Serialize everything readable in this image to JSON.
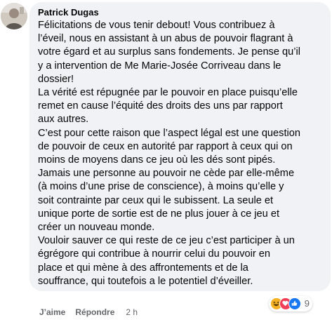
{
  "comment": {
    "author": "Patrick Dugas",
    "paragraphs": [
      "Félicitations de vous tenir debout! Vous contribuez à\nl’éveil, nous en assistant à un abus de pouvoir flagrant à\nvotre égard et au surplus sans fondements. Je pense qu’il\ny a intervention de Me Marie-Josée Corriveau dans le\ndossier!",
      "La vérité est répugnée par le pouvoir en place puisqu’elle\nremet en cause l’équité des droits des uns par rapport\naux autres.",
      "C’est pour cette raison que l’aspect légal est une question\nde pouvoir de ceux en autorité par rapport à ceux qui on\nmoins de moyens dans ce jeu où les dés sont pipés.",
      "Jamais une personne au pouvoir ne cède par elle-même\n(à moins d’une prise de conscience), à moins qu’elle y\nsoit contrainte par ceux qui le subissent. La seule et\nunique porte de sortie est de ne plus jouer à ce jeu et\ncréer un nouveau monde.",
      "Vouloir sauver ce qui reste de ce jeu c’est participer à un\négrégore qui contribue à nourrir celui du pouvoir en\nplace et qui mène à des affrontements et de la\nsouffrance, qui toutefois a le potentiel d’éveiller."
    ]
  },
  "actions": {
    "like_label": "J’aime",
    "reply_label": "Répondre",
    "timestamp": "2 h"
  },
  "reactions": {
    "icons": [
      "haha-icon",
      "love-icon",
      "like-icon"
    ],
    "count": "9",
    "colors": {
      "haha": "#f7b125",
      "love": "#f33e58",
      "like": "#1877f2"
    }
  },
  "colors": {
    "bubble": "#f0f2f5",
    "text": "#050505",
    "secondary": "#65676b"
  }
}
